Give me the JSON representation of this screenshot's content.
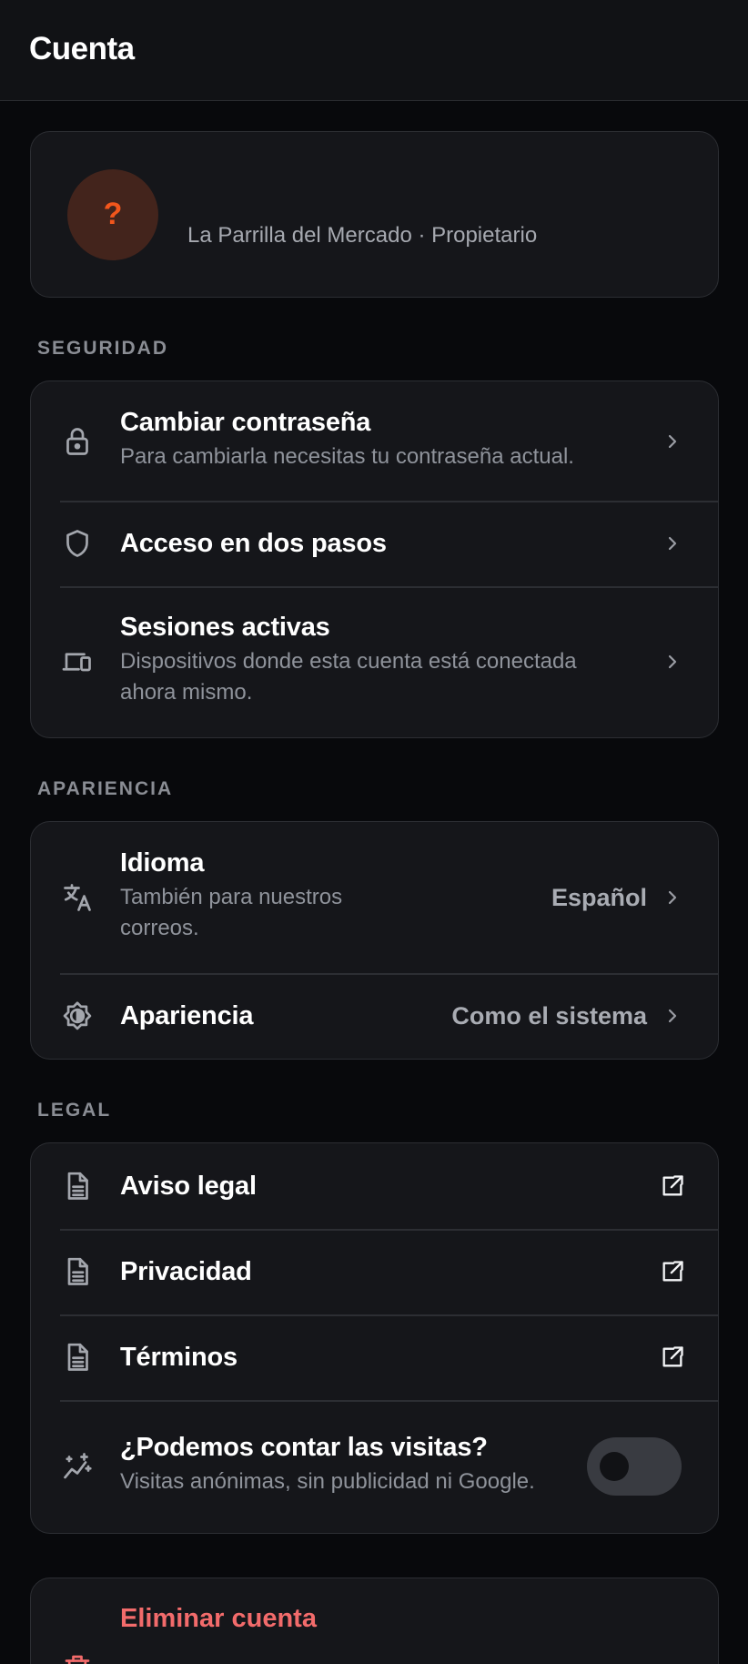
{
  "header": {
    "title": "Cuenta"
  },
  "profile": {
    "avatar_glyph": "?",
    "subtitle": "La Parrilla del Mercado · Propietario"
  },
  "security": {
    "section_title": "SEGURIDAD",
    "items": [
      {
        "icon": "lock-icon",
        "title": "Cambiar contraseña",
        "subtitle": "Para cambiarla necesitas tu contraseña actual."
      },
      {
        "icon": "shield-icon",
        "title": "Acceso en dos pasos"
      },
      {
        "icon": "devices-icon",
        "title": "Sesiones activas",
        "subtitle": "Dispositivos donde esta cuenta está conectada ahora mismo."
      }
    ]
  },
  "appearance": {
    "section_title": "APARIENCIA",
    "items": [
      {
        "icon": "translate-icon",
        "title": "Idioma",
        "subtitle": "También para nuestros correos.",
        "value": "Español"
      },
      {
        "icon": "brightness-icon",
        "title": "Apariencia",
        "value": "Como el sistema"
      }
    ]
  },
  "legal": {
    "section_title": "LEGAL",
    "items": [
      {
        "icon": "document-icon",
        "title": "Aviso legal"
      },
      {
        "icon": "document-icon",
        "title": "Privacidad"
      },
      {
        "icon": "document-icon",
        "title": "Términos"
      }
    ],
    "analytics": {
      "icon": "sparkle-chart-icon",
      "title": "¿Podemos contar las visitas?",
      "subtitle": "Visitas anónimas, sin publicidad ni Google.",
      "enabled": false
    }
  },
  "danger": {
    "title": "Eliminar cuenta"
  },
  "colors": {
    "accent_orange": "#f2561c",
    "danger_red": "#f26b6b",
    "background": "#08090c",
    "card": "#15161a"
  }
}
